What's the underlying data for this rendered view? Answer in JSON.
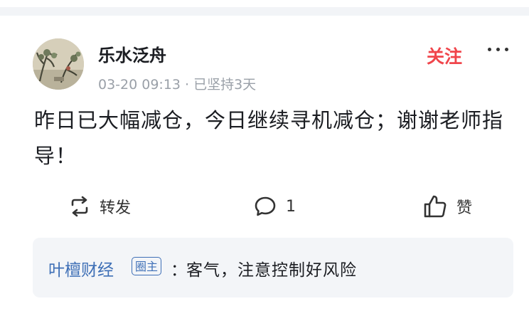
{
  "post": {
    "author": "乐水泛舟",
    "timestamp": "03-20 09:13",
    "meta_separator": "·",
    "streak": "已坚持3天",
    "follow_label": "关注",
    "text": "昨日已大幅减仓，今日继续寻机减仓；谢谢老师指导！"
  },
  "actions": {
    "repost_label": "转发",
    "comment_count": "1",
    "like_label": "赞"
  },
  "reply": {
    "author": "叶檀财经",
    "badge": "圈主",
    "colon": "：",
    "text": "客气，注意控制好风险"
  },
  "icons": {
    "more": "more-dots-icon",
    "repost": "repost-icon",
    "comment": "comment-icon",
    "like": "thumbs-up-icon"
  },
  "colors": {
    "follow": "#f0454b",
    "link": "#3e6fb6",
    "muted": "#9aa0a8"
  }
}
